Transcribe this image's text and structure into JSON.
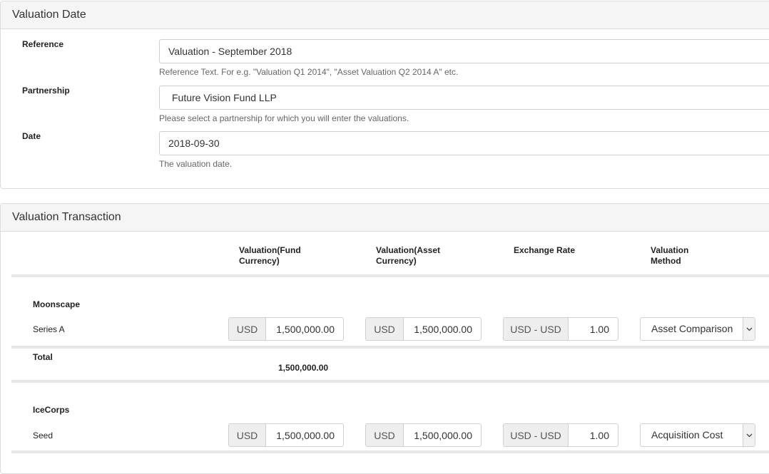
{
  "valuation_date": {
    "title": "Valuation Date",
    "reference": {
      "label": "Reference",
      "value": "Valuation - September 2018",
      "help": "Reference Text. For e.g. \"Valuation Q1 2014\", \"Asset Valuation Q2 2014 A\" etc."
    },
    "partnership": {
      "label": "Partnership",
      "value": "Future Vision Fund LLP",
      "help": "Please select a partnership for which you will enter the valuations."
    },
    "date": {
      "label": "Date",
      "value": "2018-09-30",
      "help": "The valuation date."
    }
  },
  "valuation_transaction": {
    "title": "Valuation Transaction",
    "columns": {
      "fund_currency": [
        "Valuation(Fund",
        "Currency)"
      ],
      "asset_currency": [
        "Valuation(Asset",
        "Currency)"
      ],
      "exchange_rate": [
        "Exchange Rate"
      ],
      "method": [
        "Valuation",
        "Method"
      ]
    },
    "groups": [
      {
        "name": "Moonscape",
        "row": {
          "label": "Series A",
          "fund_currency": "USD",
          "fund_value": "1,500,000.00",
          "asset_currency": "USD",
          "asset_value": "1,500,000.00",
          "pair": "USD - USD",
          "rate": "1.00",
          "method": "Asset Comparison"
        },
        "total_label": "Total",
        "total_value": "1,500,000.00"
      },
      {
        "name": "IceCorps",
        "row": {
          "label": "Seed",
          "fund_currency": "USD",
          "fund_value": "1,500,000.00",
          "asset_currency": "USD",
          "asset_value": "1,500,000.00",
          "pair": "USD - USD",
          "rate": "1.00",
          "method": "Acquisition Cost"
        }
      }
    ]
  }
}
